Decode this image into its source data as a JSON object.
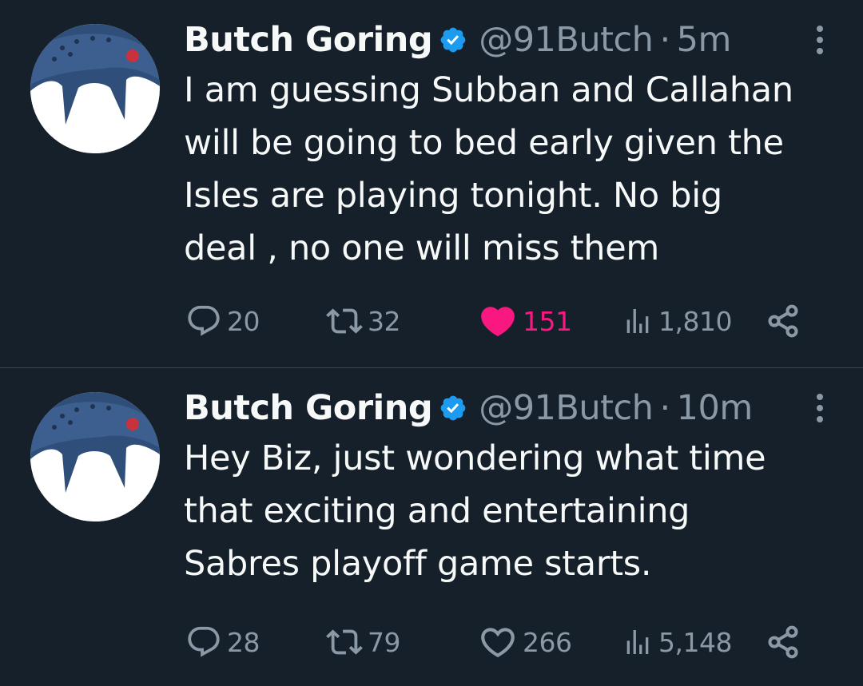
{
  "colors": {
    "background": "#15202b",
    "text_primary": "#f7f9f9",
    "text_secondary": "#8b98a5",
    "verified_blue": "#1d9bf0",
    "like_pink": "#f91880",
    "divider": "#38444d"
  },
  "tweets": [
    {
      "author_name": "Butch Goring",
      "handle": "@91Butch",
      "separator": "·",
      "time": "5m",
      "verified_icon": "verified-badge-icon",
      "text": "I am guessing Subban and Callahan\nwill be going to bed early given the\nIsles are playing tonight. No big\ndeal , no one will miss them",
      "replies": "20",
      "retweets": "32",
      "likes": "151",
      "liked": true,
      "views": "1,810"
    },
    {
      "author_name": "Butch Goring",
      "handle": "@91Butch",
      "separator": "·",
      "time": "10m",
      "verified_icon": "verified-badge-icon",
      "text": "Hey Biz, just wondering what time\nthat exciting and entertaining\nSabres playoff game starts.",
      "replies": "28",
      "retweets": "79",
      "likes": "266",
      "liked": false,
      "views": "5,148"
    }
  ]
}
